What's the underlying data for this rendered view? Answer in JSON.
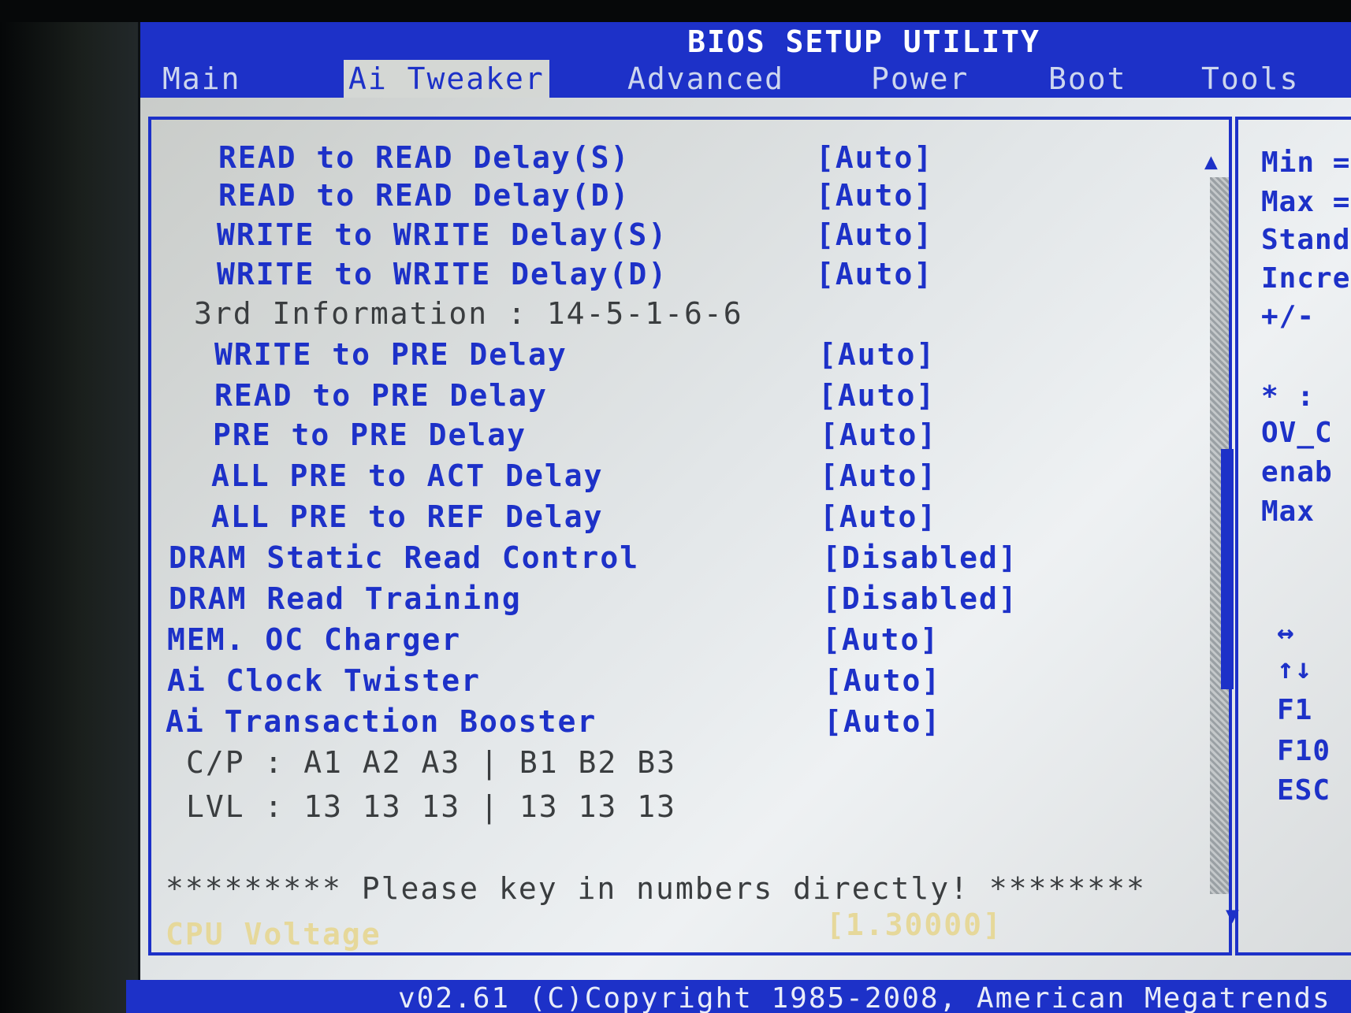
{
  "title": "BIOS SETUP UTILITY",
  "tabs": [
    {
      "label": "Main"
    },
    {
      "label": "Ai Tweaker"
    },
    {
      "label": "Advanced"
    },
    {
      "label": "Power"
    },
    {
      "label": "Boot"
    },
    {
      "label": "Tools"
    }
  ],
  "settings": [
    {
      "label": "READ to READ Delay(S)",
      "value": "[Auto]"
    },
    {
      "label": "READ to READ Delay(D)",
      "value": "[Auto]"
    },
    {
      "label": "WRITE to WRITE Delay(S)",
      "value": "[Auto]"
    },
    {
      "label": "WRITE to WRITE Delay(D)",
      "value": "[Auto]"
    },
    {
      "label": "3rd Information : 14-5-1-6-6",
      "value": ""
    },
    {
      "label": "WRITE to PRE Delay",
      "value": "[Auto]"
    },
    {
      "label": "READ to PRE Delay",
      "value": "[Auto]"
    },
    {
      "label": "PRE to PRE Delay",
      "value": "[Auto]"
    },
    {
      "label": "ALL PRE to ACT Delay",
      "value": "[Auto]"
    },
    {
      "label": "ALL PRE to REF Delay",
      "value": "[Auto]"
    },
    {
      "label": "DRAM Static Read Control",
      "value": "[Disabled]"
    },
    {
      "label": "DRAM Read Training",
      "value": "[Disabled]"
    },
    {
      "label": "MEM. OC Charger",
      "value": "[Auto]"
    },
    {
      "label": "Ai Clock Twister",
      "value": "[Auto]"
    },
    {
      "label": "Ai Transaction Booster",
      "value": "[Auto]"
    }
  ],
  "cp_line": "C/P : A1 A2 A3 | B1 B2 B3",
  "lvl_line": "LVL : 13 13 13 | 13 13 13",
  "notice": {
    "stars_left": "*********",
    "text": "Please key in numbers directly!",
    "stars_right": "********"
  },
  "selected": {
    "label": "CPU Voltage",
    "value": "[1.30000]"
  },
  "help_panel": [
    "Min =",
    "Max =",
    "Stand",
    "Incre",
    "+/-",
    "* : ",
    "OV_C",
    "enab",
    "Max",
    "↔",
    "↑↓",
    "F1",
    "F10",
    "ESC"
  ],
  "footer": "v02.61 (C)Copyright 1985-2008, American Megatrends",
  "icons": {
    "scroll_up": "scroll-up-arrow-icon",
    "scroll_down": "scroll-down-arrow-icon"
  },
  "colors": {
    "bios_blue": "#1d31c8",
    "panel_gray": "#e2e6e8",
    "highlight": "#e6d89a"
  }
}
